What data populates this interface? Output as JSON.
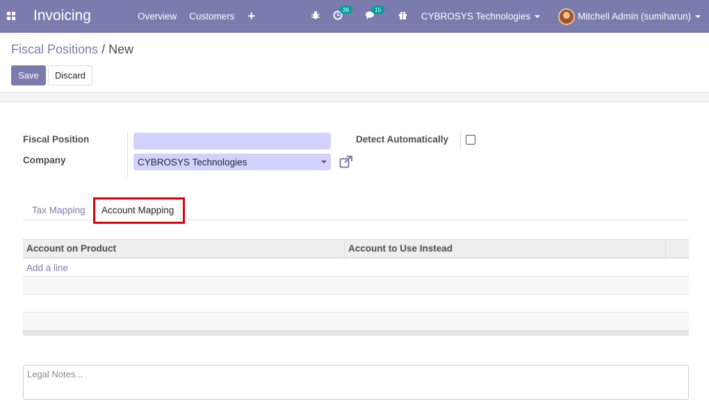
{
  "navbar": {
    "app_title": "Invoicing",
    "menu": [
      "Overview",
      "Customers"
    ],
    "plus_label": "+",
    "activity_count": "36",
    "messages_count": "15",
    "company": "CYBROSYS Technologies",
    "user": "Mitchell Admin (sumiharun)"
  },
  "control_panel": {
    "breadcrumb_parent": "Fiscal Positions",
    "breadcrumb_sep": "/",
    "breadcrumb_current": "New",
    "save_label": "Save",
    "discard_label": "Discard"
  },
  "form": {
    "fiscal_position_label": "Fiscal Position",
    "fiscal_position_value": "",
    "company_label": "Company",
    "company_value": "CYBROSYS Technologies",
    "detect_label": "Detect Automatically",
    "detect_checked": false
  },
  "tabs": [
    {
      "label": "Tax Mapping",
      "active": false
    },
    {
      "label": "Account Mapping",
      "active": true
    }
  ],
  "table": {
    "columns": [
      "Account on Product",
      "Account to Use Instead"
    ],
    "add_line_label": "Add a line"
  },
  "notes": {
    "placeholder": "Legal Notes..."
  },
  "colors": {
    "brand": "#7c7bad",
    "input_required": "#d2d2ff",
    "highlight": "#e0000b"
  }
}
